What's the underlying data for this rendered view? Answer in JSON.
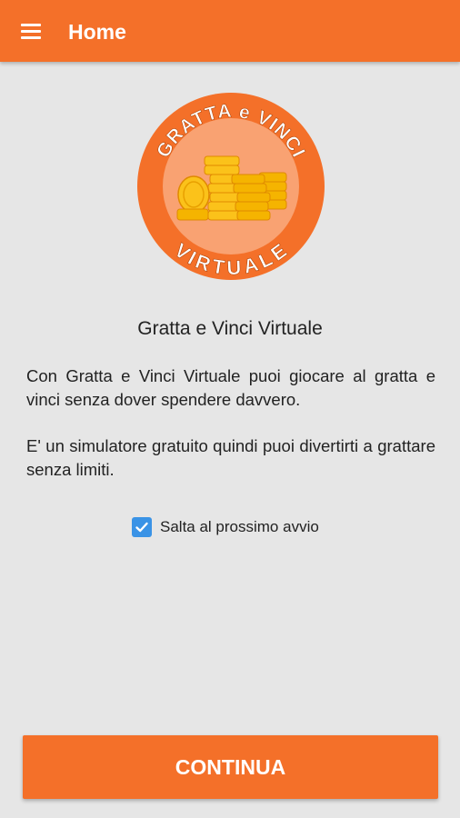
{
  "app_bar": {
    "title": "Home",
    "menu_icon": "hamburger-menu-icon"
  },
  "logo": {
    "top_text": "GRATTA e VINCI",
    "bottom_text": "VIRTUALE",
    "icon": "coin-stacks-icon"
  },
  "main": {
    "app_name": "Gratta e Vinci Virtuale",
    "paragraph1": "Con Gratta e Vinci Virtuale puoi giocare al gratta e vinci senza dover spendere davvero.",
    "paragraph2": "E' un simulatore gratuito quindi puoi divertirti a grattare senza limiti."
  },
  "checkbox": {
    "label": "Salta al prossimo avvio",
    "checked": true
  },
  "continue_button": {
    "label": "CONTINUA"
  },
  "colors": {
    "accent": "#f47029",
    "checkbox": "#3a93e6",
    "background": "#e6e6e6"
  }
}
